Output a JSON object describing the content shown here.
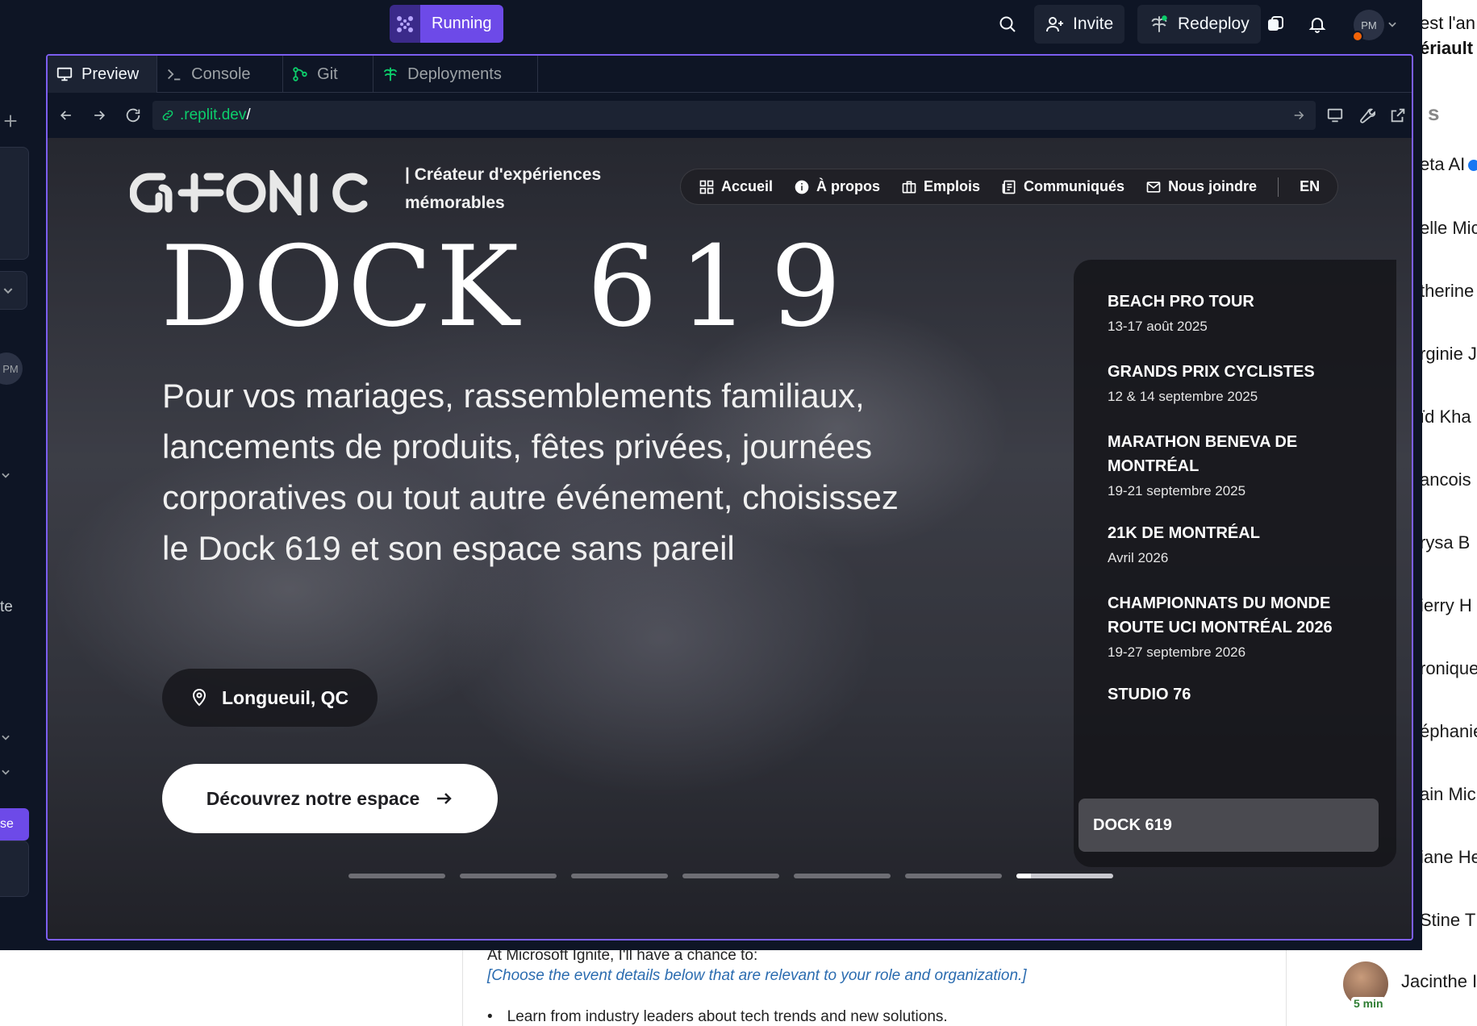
{
  "background": {
    "right_panel": {
      "header_line1": "est l'an",
      "header_line2": "ériault",
      "section_fragment": "s",
      "contacts": [
        "eta AI",
        "elle Mic",
        "therine",
        "rginie J",
        "ïd Kha",
        "ancois",
        "rysa B",
        "ierry H",
        "ronique",
        "éphanie",
        "ain Mich",
        "iane He",
        "Stine T"
      ],
      "last_contact": "Jacinthe I",
      "last_badge": "5 min"
    },
    "doc": {
      "line1": "At Microsoft Ignite, I'll have a chance to:",
      "line2": "[Choose the event details below that are relevant to your role and organization.]",
      "bullet1": "Learn from industry leaders about tech trends and new solutions."
    }
  },
  "replit": {
    "run_label": "Running",
    "invite_label": "Invite",
    "redeploy_label": "Redeploy",
    "avatar_initials": "PM",
    "left_strip": {
      "initials": "PM",
      "frag1": "te",
      "frag2": "se"
    },
    "tabs": [
      {
        "label": "Preview",
        "icon": "monitor-icon"
      },
      {
        "label": "Console",
        "icon": "terminal-icon"
      },
      {
        "label": "Git",
        "icon": "git-icon"
      },
      {
        "label": "Deployments",
        "icon": "deployments-icon"
      }
    ],
    "url": {
      "host": ".replit.dev",
      "path": "/"
    }
  },
  "site": {
    "tagline": "| Créateur d'expériences mémorables",
    "nav": [
      {
        "label": "Accueil",
        "icon": "grid-icon"
      },
      {
        "label": "À propos",
        "icon": "info-icon"
      },
      {
        "label": "Emplois",
        "icon": "briefcase-icon"
      },
      {
        "label": "Communiqués",
        "icon": "news-icon"
      },
      {
        "label": "Nous joindre",
        "icon": "mail-icon"
      }
    ],
    "lang": "EN",
    "hero_title_word": "DOCK",
    "hero_title_num": "619",
    "hero_subtitle": "Pour vos mariages, rassemblements familiaux, lancements de produits, fêtes privées, journées corporatives ou tout autre événement, choisissez le Dock 619 et son espace sans pareil",
    "location": "Longueuil, QC",
    "cta": "Découvrez notre espace",
    "events": [
      {
        "name": "BEACH PRO TOUR",
        "date": "13-17 août 2025"
      },
      {
        "name": "GRANDS PRIX CYCLISTES",
        "date": "12 & 14 septembre 2025"
      },
      {
        "name": "MARATHON BENEVA DE MONTRÉAL",
        "date": "19-21 septembre 2025"
      },
      {
        "name": "21K DE MONTRÉAL",
        "date": "Avril 2026"
      },
      {
        "name": "CHAMPIONNATS DU MONDE ROUTE UCI MONTRÉAL 2026",
        "date": "19-27 septembre 2026"
      },
      {
        "name": "STUDIO 76",
        "date": ""
      }
    ],
    "active_event": "DOCK 619",
    "slides": {
      "count": 7,
      "active_index": 6,
      "active_progress": 0.15
    }
  }
}
